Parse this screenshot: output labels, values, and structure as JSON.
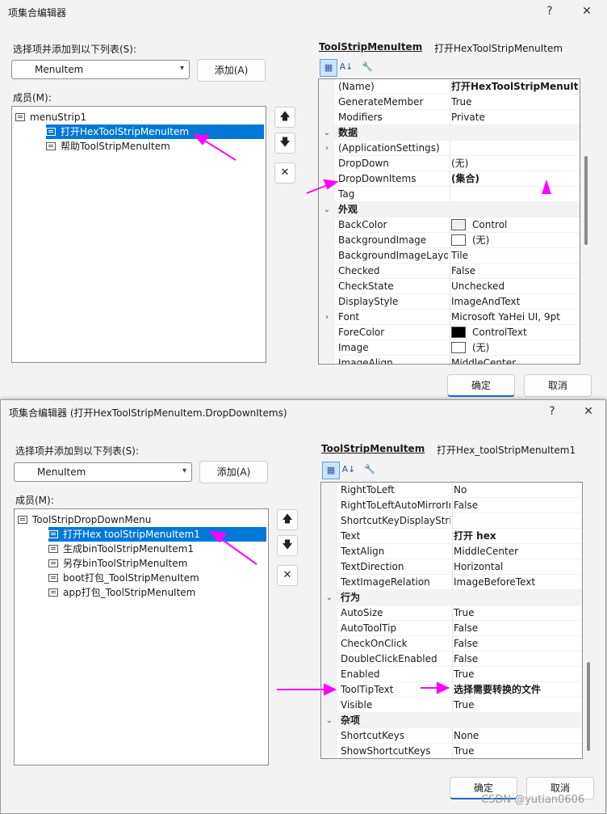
{
  "dialog1": {
    "title": "项集合编辑器",
    "help": "?",
    "close": "✕",
    "select_label": "选择项并添加到以下列表(S):",
    "combo_value": "MenuItem",
    "add_button": "添加(A)",
    "members_label": "成员(M):",
    "tree": [
      {
        "label": "menuStrip1",
        "level": 0,
        "selected": false
      },
      {
        "label": "打开HexToolStripMenuItem",
        "level": 1,
        "selected": true
      },
      {
        "label": "帮助ToolStripMenuItem",
        "level": 1,
        "selected": false
      }
    ],
    "prop_type": "ToolStripMenuItem",
    "prop_name": "打开HexToolStripMenuItem",
    "rows": [
      {
        "name": "(Name)",
        "value": "打开HexToolStripMenuItem",
        "bold": true
      },
      {
        "name": "GenerateMember",
        "value": "True"
      },
      {
        "name": "Modifiers",
        "value": "Private"
      },
      {
        "cat": true,
        "name": "数据"
      },
      {
        "name": "(ApplicationSettings)",
        "value": "",
        "expand": true
      },
      {
        "name": "DropDown",
        "value": "(无)"
      },
      {
        "name": "DropDownItems",
        "value": "(集合)",
        "bold": true
      },
      {
        "name": "Tag",
        "value": ""
      },
      {
        "cat": true,
        "name": "外观"
      },
      {
        "name": "BackColor",
        "value": "Control",
        "swatch": "#f0f0f0"
      },
      {
        "name": "BackgroundImage",
        "value": "(无)",
        "swatch": "#ffffff"
      },
      {
        "name": "BackgroundImageLayout",
        "value": "Tile"
      },
      {
        "name": "Checked",
        "value": "False"
      },
      {
        "name": "CheckState",
        "value": "Unchecked"
      },
      {
        "name": "DisplayStyle",
        "value": "ImageAndText"
      },
      {
        "name": "Font",
        "value": "Microsoft YaHei UI, 9pt",
        "expand": true
      },
      {
        "name": "ForeColor",
        "value": "ControlText",
        "swatch": "#000000"
      },
      {
        "name": "Image",
        "value": "(无)",
        "swatch": "#ffffff"
      },
      {
        "name": "ImageAlign",
        "value": "MiddleCenter"
      }
    ],
    "ok_button": "确定",
    "cancel_button": "取消"
  },
  "dialog2": {
    "title": "项集合编辑器 (打开HexToolStripMenuItem.DropDownItems)",
    "help": "?",
    "close": "✕",
    "select_label": "选择项并添加到以下列表(S):",
    "combo_value": "MenuItem",
    "add_button": "添加(A)",
    "members_label": "成员(M):",
    "tree": [
      {
        "label": "ToolStripDropDownMenu",
        "level": 0,
        "selected": false
      },
      {
        "label": "打开Hex toolStripMenuItem1",
        "level": 1,
        "selected": true
      },
      {
        "label": "生成binToolStripMenuItem1",
        "level": 1,
        "selected": false
      },
      {
        "label": "另存binToolStripMenuItem",
        "level": 1,
        "selected": false
      },
      {
        "label": "boot打包_ToolStripMenuItem",
        "level": 1,
        "selected": false
      },
      {
        "label": "app打包_ToolStripMenuItem",
        "level": 1,
        "selected": false
      }
    ],
    "prop_type": "ToolStripMenuItem",
    "prop_name": "打开Hex_toolStripMenuItem1",
    "rows": [
      {
        "name": "RightToLeft",
        "value": "No"
      },
      {
        "name": "RightToLeftAutoMirrorImage",
        "value": "False"
      },
      {
        "name": "ShortcutKeyDisplayString",
        "value": ""
      },
      {
        "name": "Text",
        "value": "打开 hex",
        "bold": true
      },
      {
        "name": "TextAlign",
        "value": "MiddleCenter"
      },
      {
        "name": "TextDirection",
        "value": "Horizontal"
      },
      {
        "name": "TextImageRelation",
        "value": "ImageBeforeText"
      },
      {
        "cat": true,
        "name": "行为"
      },
      {
        "name": "AutoSize",
        "value": "True"
      },
      {
        "name": "AutoToolTip",
        "value": "False"
      },
      {
        "name": "CheckOnClick",
        "value": "False"
      },
      {
        "name": "DoubleClickEnabled",
        "value": "False"
      },
      {
        "name": "Enabled",
        "value": "True"
      },
      {
        "name": "ToolTipText",
        "value": "选择需要转换的文件",
        "bold": true
      },
      {
        "name": "Visible",
        "value": "True"
      },
      {
        "cat": true,
        "name": "杂项"
      },
      {
        "name": "ShortcutKeys",
        "value": "None"
      },
      {
        "name": "ShowShortcutKeys",
        "value": "True"
      }
    ],
    "ok_button": "确定",
    "cancel_button": "取消"
  },
  "icons": {
    "up": "🡅",
    "down": "🡇",
    "delete": "✕",
    "categorized": "▦",
    "alphabetical": "A↓",
    "properties": "🔧"
  },
  "watermark": "CSDN @yutian0606",
  "colors": {
    "selection": "#0078d7",
    "annotation_arrow": "#ff00ff",
    "primary_border": "#1b67c7"
  }
}
